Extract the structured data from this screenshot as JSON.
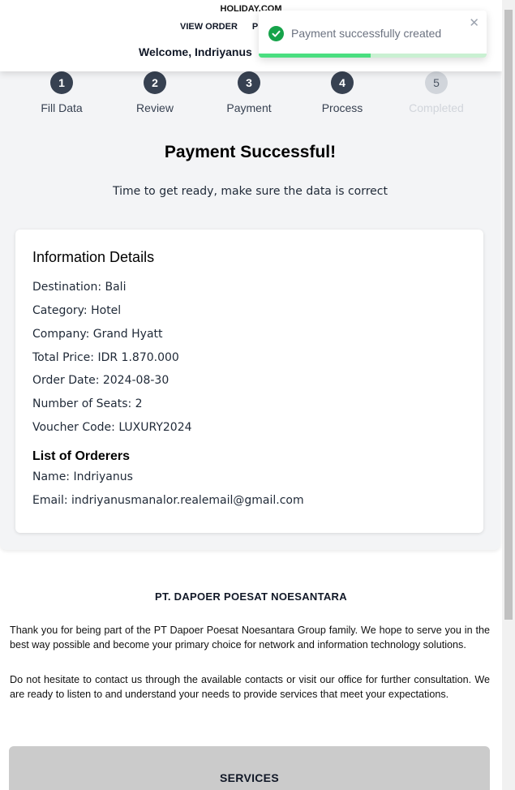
{
  "header": {
    "brand": "HOLIDAY.COM",
    "nav": [
      "VIEW ORDER",
      "P"
    ],
    "welcome": "Welcome, Indriyanus"
  },
  "stepper": {
    "steps": [
      {
        "num": "1",
        "label": "Fill Data"
      },
      {
        "num": "2",
        "label": "Review"
      },
      {
        "num": "3",
        "label": "Payment"
      },
      {
        "num": "4",
        "label": "Process"
      },
      {
        "num": "5",
        "label": "Completed"
      }
    ]
  },
  "status": {
    "title": "Payment Successful!",
    "subtitle": "Time to get ready, make sure the data is correct"
  },
  "details": {
    "title": "Information Details",
    "destination": "Destination: Bali",
    "category": "Category: Hotel",
    "company": "Company: Grand Hyatt",
    "total_price": "Total Price: IDR 1.870.000",
    "order_date": "Order Date: 2024-08-30",
    "seats": "Number of Seats: 2",
    "voucher": "Voucher Code: LUXURY2024"
  },
  "orderers": {
    "title": "List of Orderers",
    "name": "Name: Indriyanus",
    "email": "Email: indriyanusmanalor.realemail@gmail.com"
  },
  "footer": {
    "company": "PT. DAPOER POESAT NOESANTARA",
    "paragraph1": "Thank you for being part of the PT Dapoer Poesat Noesantara Group family. We hope to serve you in the best way possible and become your primary choice for network and information technology solutions.",
    "paragraph2": "Do not hesitate to contact us through the available contacts or visit our office for further consultation. We are ready to listen to and understand your needs to provide services that meet your expectations.",
    "services_title": "SERVICES"
  },
  "toast": {
    "message": "Payment successfully created",
    "close": "✕",
    "progress": 0.49
  },
  "colors": {
    "step_active": "#374151",
    "step_disabled": "#d1d5db",
    "success": "#16a34a"
  }
}
